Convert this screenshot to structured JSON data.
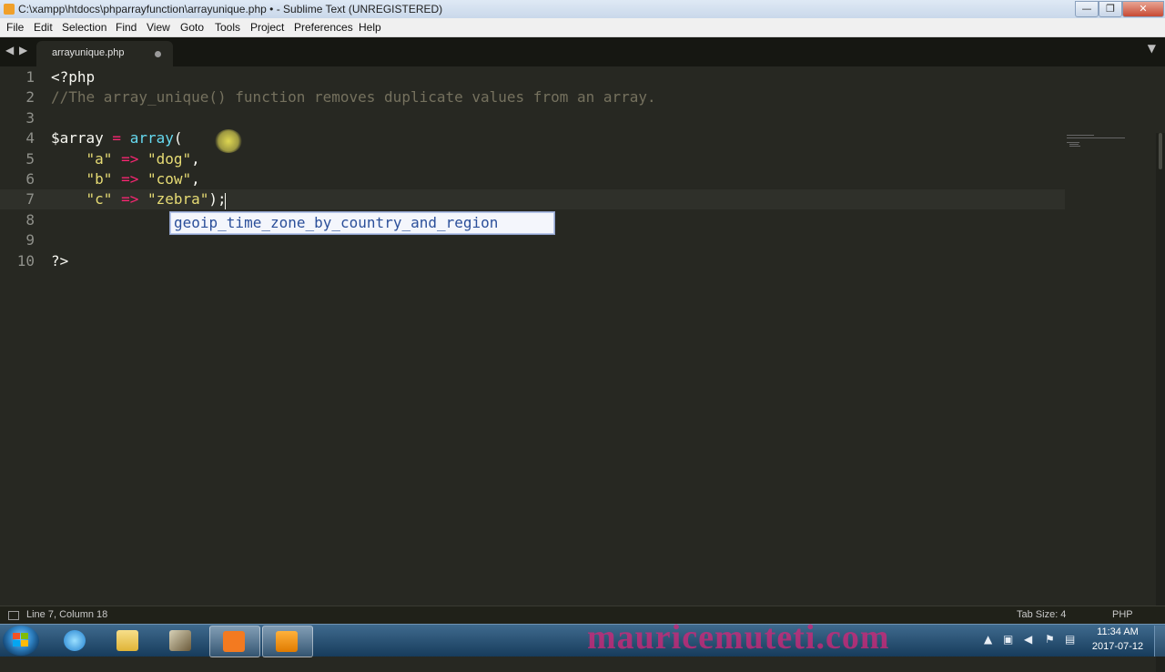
{
  "window": {
    "title": "C:\\xampp\\htdocs\\phparrayfunction\\arrayunique.php • - Sublime Text (UNREGISTERED)",
    "minimize": "—",
    "maximize": "❐",
    "close": "✕"
  },
  "menu": [
    "File",
    "Edit",
    "Selection",
    "Find",
    "View",
    "Goto",
    "Tools",
    "Project",
    "Preferences",
    "Help"
  ],
  "tabs": {
    "nav_left": "◀",
    "nav_right": "▶",
    "active_tab": "arrayunique.php",
    "dropdown": "▼"
  },
  "editor": {
    "line_numbers": [
      "1",
      "2",
      "3",
      "4",
      "5",
      "6",
      "7",
      "8",
      "9",
      "10"
    ],
    "current_line": 7,
    "lines": [
      [
        {
          "t": "<?php",
          "c": "tag"
        }
      ],
      [
        {
          "t": "//The array_unique() function removes duplicate values from an array.",
          "c": "comment"
        }
      ],
      [],
      [
        {
          "t": "$array",
          "c": "var"
        },
        {
          "t": " = ",
          "c": "op"
        },
        {
          "t": "array",
          "c": "fn"
        },
        {
          "t": "(",
          "c": "punc"
        }
      ],
      [
        {
          "t": "    ",
          "c": "punc"
        },
        {
          "t": "\"a\"",
          "c": "str"
        },
        {
          "t": " => ",
          "c": "op"
        },
        {
          "t": "\"dog\"",
          "c": "str"
        },
        {
          "t": ",",
          "c": "punc"
        }
      ],
      [
        {
          "t": "    ",
          "c": "punc"
        },
        {
          "t": "\"b\"",
          "c": "str"
        },
        {
          "t": " => ",
          "c": "op"
        },
        {
          "t": "\"cow\"",
          "c": "str"
        },
        {
          "t": ",",
          "c": "punc"
        }
      ],
      [
        {
          "t": "    ",
          "c": "punc"
        },
        {
          "t": "\"c\"",
          "c": "str"
        },
        {
          "t": " => ",
          "c": "op"
        },
        {
          "t": "\"zebra\"",
          "c": "str"
        },
        {
          "t": ");",
          "c": "punc"
        }
      ],
      [],
      [],
      [
        {
          "t": "?>",
          "c": "tag"
        }
      ]
    ],
    "autocomplete_suggestion": "geoip_time_zone_by_country_and_region"
  },
  "status": {
    "position": "Line 7, Column 18",
    "tab_size": "Tab Size: 4",
    "syntax": "PHP"
  },
  "taskbar": {
    "apps": [
      "start-orb",
      "internet-explorer",
      "file-explorer",
      "installer",
      "xampp",
      "sublime-text"
    ],
    "watermark": "mauricemuteti.com",
    "clock_time": "11:34 AM",
    "clock_date": "2017-07-12"
  },
  "colors": {
    "editor_bg": "#272822",
    "keyword": "#f92672",
    "function": "#66d9ef",
    "string": "#e6db74",
    "comment": "#75715e"
  }
}
